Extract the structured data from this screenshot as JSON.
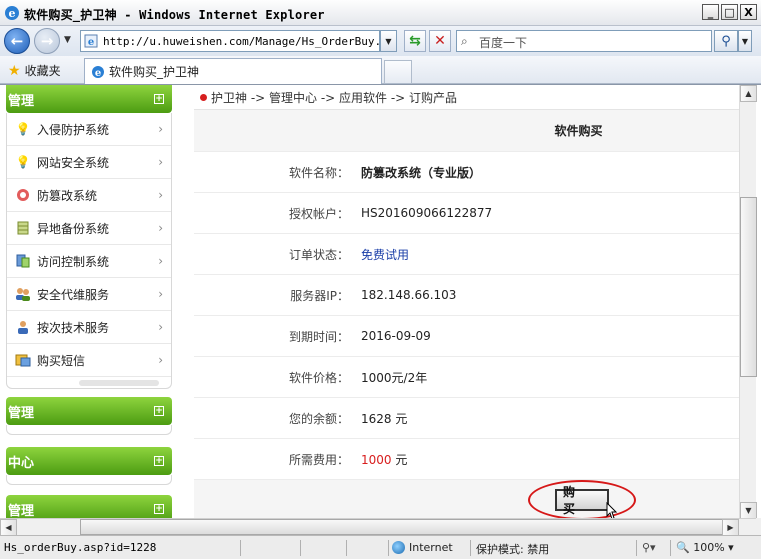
{
  "window": {
    "title": "软件购买_护卫神 - Windows Internet Explorer",
    "buttons": {
      "minimize": "_",
      "maximize": "□",
      "close": "X"
    }
  },
  "address_bar": {
    "url": "http://u.huweishen.com/Manage/Hs_OrderBuy.asp?",
    "search_placeholder": "百度一下"
  },
  "favorites_bar": {
    "favorites_label": "收藏夹",
    "tab_title": "软件购买_护卫神"
  },
  "sidebar": {
    "header": "管理",
    "items": [
      {
        "label": "入侵防护系统",
        "icon": "bulb-icon"
      },
      {
        "label": "网站安全系统",
        "icon": "bulb-icon"
      },
      {
        "label": "防篡改系统",
        "icon": "shield-icon"
      },
      {
        "label": "异地备份系统",
        "icon": "database-icon"
      },
      {
        "label": "访问控制系统",
        "icon": "access-icon"
      },
      {
        "label": "安全代维服务",
        "icon": "users-icon"
      },
      {
        "label": "按次技术服务",
        "icon": "user-icon"
      },
      {
        "label": "购买短信",
        "icon": "sms-icon"
      }
    ],
    "groups": [
      "管理",
      "中心",
      "管理"
    ]
  },
  "breadcrumb": "护卫神 -> 管理中心 -> 应用软件 -> 订购产品",
  "panel": {
    "title": "软件购买",
    "rows": [
      {
        "key": "软件名称：",
        "value": "防篡改系统（专业版）"
      },
      {
        "key": "授权帐户：",
        "value": "HS201609066122877"
      },
      {
        "key": "订单状态：",
        "value": "免费试用"
      },
      {
        "key": "服务器IP：",
        "value": "182.148.66.103"
      },
      {
        "key": "到期时间：",
        "value": "2016-09-09"
      },
      {
        "key": "软件价格：",
        "value": "1000元/2年"
      },
      {
        "key": "您的余额：",
        "value": "1628 元"
      }
    ],
    "fee": {
      "key": "所需费用：",
      "amount": "1000",
      "unit": " 元"
    },
    "buy_label": "购 买"
  },
  "status_bar": {
    "url": "Hs_orderBuy.asp?id=1228",
    "zone": "Internet",
    "mode": "保护模式: 禁用",
    "zoom": "100%"
  },
  "colors": {
    "sidebar_green": "#5aae18",
    "fee_red": "#d81e1e",
    "status_link_blue": "#1a3ea8",
    "annotation_ring": "#d61818"
  }
}
